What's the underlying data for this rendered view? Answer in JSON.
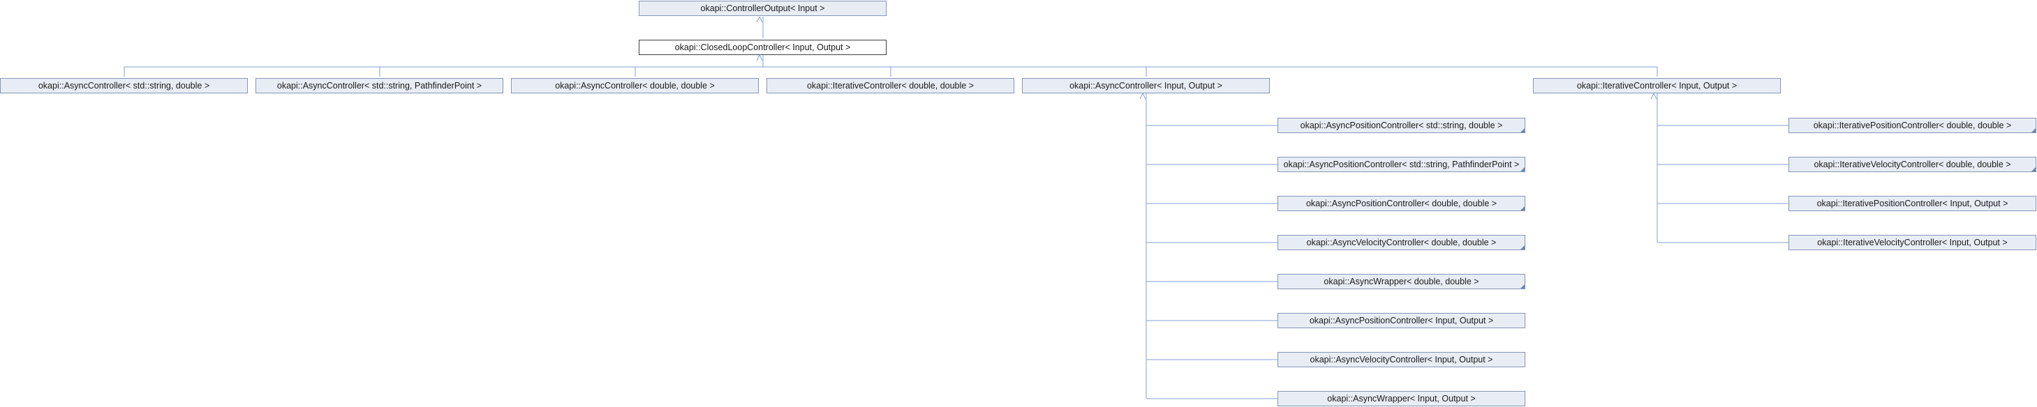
{
  "nodes": {
    "controller_output": "okapi::ControllerOutput< Input >",
    "closed_loop": "okapi::ClosedLoopController< Input, Output >",
    "async_string_double": "okapi::AsyncController< std::string, double >",
    "async_string_pathfinder": "okapi::AsyncController< std::string, PathfinderPoint >",
    "async_double_double": "okapi::AsyncController< double, double >",
    "iterative_double_double": "okapi::IterativeController< double, double >",
    "async_input_output": "okapi::AsyncController< Input, Output >",
    "iterative_input_output": "okapi::IterativeController< Input, Output >",
    "async_pos_string_double": "okapi::AsyncPositionController< std::string, double >",
    "async_pos_string_pathfinder": "okapi::AsyncPositionController< std::string, PathfinderPoint >",
    "async_pos_double_double": "okapi::AsyncPositionController< double, double >",
    "async_vel_double_double": "okapi::AsyncVelocityController< double, double >",
    "async_wrapper_double_double": "okapi::AsyncWrapper< double, double >",
    "async_pos_input_output": "okapi::AsyncPositionController< Input, Output >",
    "async_vel_input_output": "okapi::AsyncVelocityController< Input, Output >",
    "async_wrapper_input_output": "okapi::AsyncWrapper< Input, Output >",
    "iter_pos_double_double": "okapi::IterativePositionController< double, double >",
    "iter_vel_double_double": "okapi::IterativeVelocityController< double, double >",
    "iter_pos_input_output": "okapi::IterativePositionController< Input, Output >",
    "iter_vel_input_output": "okapi::IterativeVelocityController< Input, Output >"
  },
  "colors": {
    "node_fill": "#e8edf5",
    "node_border": "#8495b5",
    "edge": "#7fa1d6",
    "current_border": "#404040"
  }
}
